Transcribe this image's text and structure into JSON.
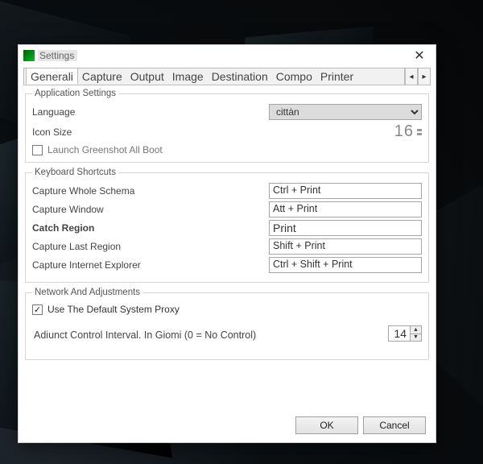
{
  "window": {
    "title": "Settings",
    "close_glyph": "✕"
  },
  "tabs": {
    "items": [
      "Generali",
      "Capture",
      "Output",
      "Image",
      "Destination",
      "Compo",
      "Printer"
    ],
    "scroll_left": "◂",
    "scroll_right": "▸"
  },
  "app_settings": {
    "legend": "Application Settings",
    "language_label": "Language",
    "language_value": "cittàn",
    "icon_size_label": "Icon Size",
    "icon_size_value": "16",
    "launch_label": "Launch Greenshot All Boot",
    "launch_checked": false
  },
  "shortcuts": {
    "legend": "Keyboard Shortcuts",
    "rows": [
      {
        "label": "Capture Whole Schema",
        "value": "Ctrl + Print"
      },
      {
        "label": "Capture Window",
        "value": "Att + Print"
      },
      {
        "label": "Catch Region",
        "value": "Print",
        "bold": true
      },
      {
        "label": "Capture Last Region",
        "value": "Shift + Print"
      },
      {
        "label": "Capture Internet Explorer",
        "value": "Ctrl + Shift + Print"
      }
    ]
  },
  "network": {
    "legend": "Network And Adjustments",
    "proxy_label": "Use The Default System Proxy",
    "proxy_checked": true,
    "interval_label": "Adiunct Control Interval. In Giomi (0 = No Control)",
    "interval_value": "14"
  },
  "buttons": {
    "ok": "OK",
    "cancel": "Cancel"
  }
}
